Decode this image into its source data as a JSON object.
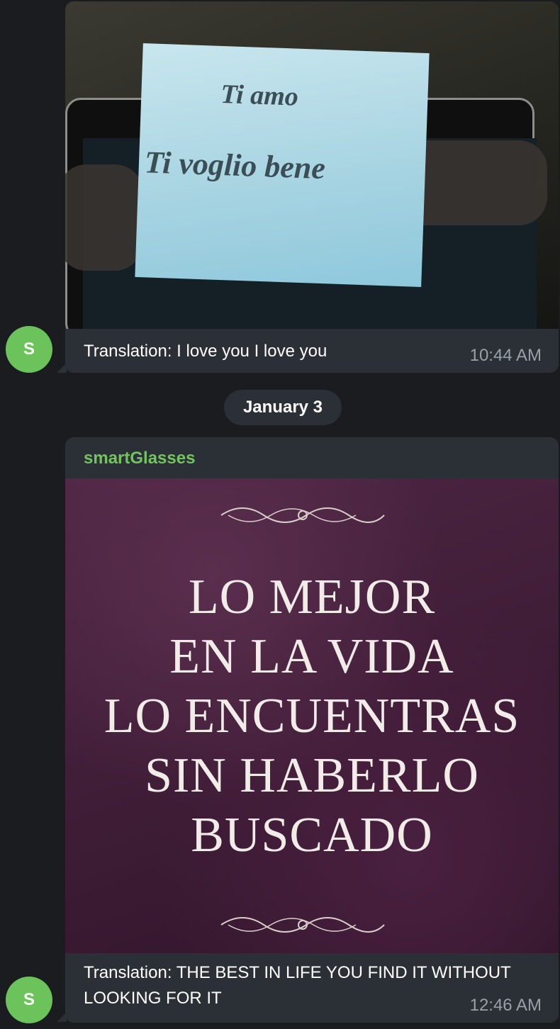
{
  "messages": [
    {
      "avatar_initial": "S",
      "photo": {
        "line1": "Ti amo",
        "line2": "Ti voglio bene"
      },
      "caption": "Translation: I love you I love you",
      "time": "10:44 AM"
    },
    {
      "avatar_initial": "S",
      "sender": "smartGlasses",
      "photo": {
        "quote_lines": [
          "LO MEJOR",
          "EN LA VIDA",
          "LO ENCUENTRAS",
          "SIN HABERLO",
          "BUSCADO"
        ]
      },
      "caption": "Translation: THE BEST IN LIFE YOU FIND IT WITHOUT LOOKING FOR IT",
      "time": "12:46 AM"
    }
  ],
  "date_separator": "January 3",
  "colors": {
    "background": "#1a1c20",
    "bubble": "#2b2f36",
    "avatar": "#6cc25b",
    "sender_name": "#72c45f",
    "timestamp": "#9aa0a8"
  }
}
